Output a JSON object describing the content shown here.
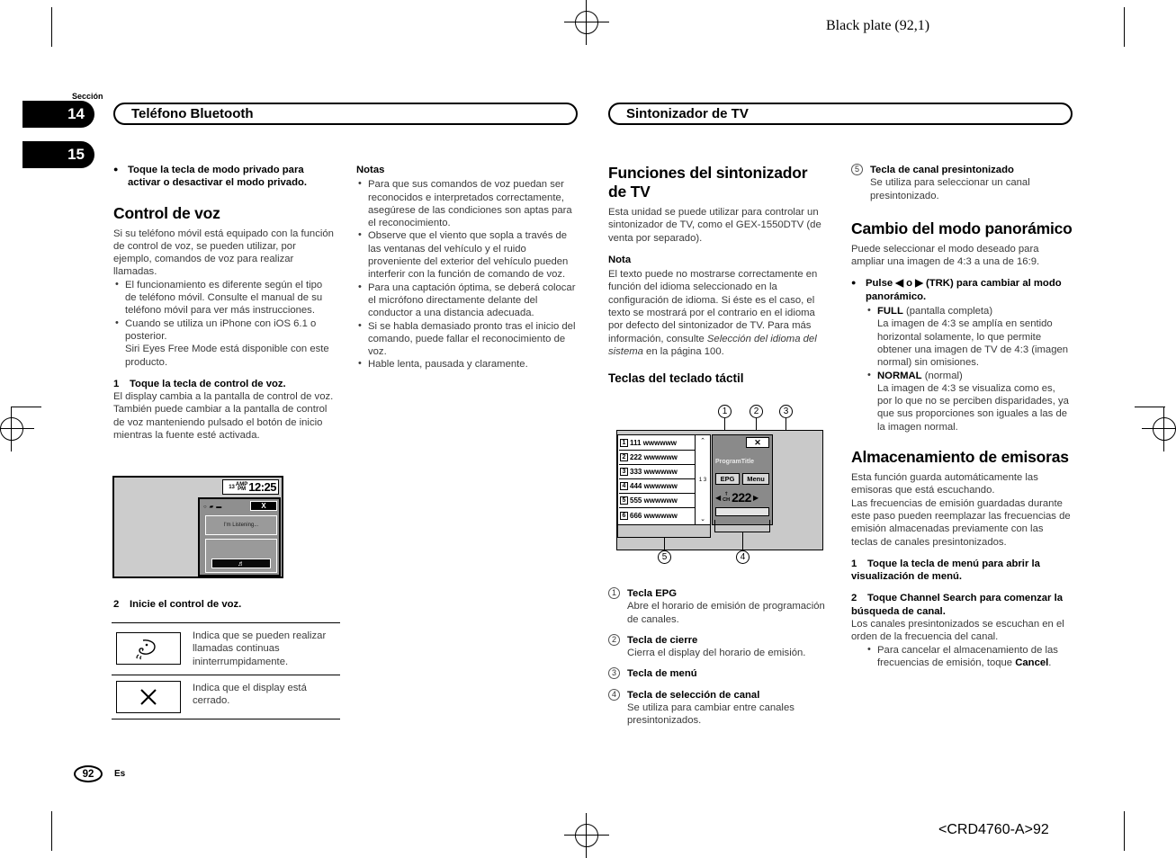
{
  "print_marks": {
    "black_plate": "Black plate (92,1)",
    "footer_code": "<CRD4760-A>92"
  },
  "section_tabs": {
    "label": "Sección",
    "numbers": [
      "14",
      "15"
    ]
  },
  "running_headers": {
    "left": "Teléfono Bluetooth",
    "right": "Sintonizador de TV"
  },
  "column1": {
    "lead_bullet": "Toque la tecla de modo privado para activar o desactivar el modo privado.",
    "heading": "Control de voz",
    "intro": "Si su teléfono móvil está equipado con la función de control de voz, se pueden utilizar, por ejemplo, comandos de voz para realizar llamadas.",
    "bullets": [
      "El funcionamiento es diferente según el tipo de teléfono móvil. Consulte el manual de su teléfono móvil para ver más instrucciones.",
      "Cuando se utiliza un iPhone con iOS 6.1 o posterior.",
      "Siri Eyes Free Mode está disponible con este producto."
    ],
    "step1_num": "1",
    "step1_title": "Toque la tecla de control de voz.",
    "step1_body": "El display cambia a la pantalla de control de voz. También puede cambiar a la pantalla de control de voz manteniendo pulsado el botón de inicio mientras la fuente esté activada.",
    "figure": {
      "clock_date": "13",
      "clock_ampm_top": "AMP",
      "clock_ampm_bottom": "PM",
      "clock_time": "12:25",
      "close_label": "X",
      "listening_text": "I'm Listening...",
      "mic_icon": "mic-icon",
      "status_icons": [
        "circle-icon",
        "signal-icon",
        "battery-icon"
      ]
    },
    "step2_num": "2",
    "step2_title": "Inicie el control de voz.",
    "icon_table": [
      {
        "icon": "speech-mouth-icon",
        "glyph": "",
        "desc": "Indica que se pueden realizar llamadas continuas ininterrumpidamente."
      },
      {
        "icon": "close-x-icon",
        "glyph": "✕",
        "desc": "Indica que el display está cerrado."
      }
    ]
  },
  "column2": {
    "notes_title": "Notas",
    "notes": [
      "Para que sus comandos de voz puedan ser reconocidos e interpretados correctamente, asegúrese de las condiciones son aptas para el reconocimiento.",
      "Observe que el viento que sopla a través de las ventanas del vehículo y el ruido proveniente del exterior del vehículo pueden interferir con la función de comando de voz.",
      "Para una captación óptima, se deberá colocar el micrófono directamente delante del conductor a una distancia adecuada.",
      "Si se habla demasiado pronto tras el inicio del comando, puede fallar el reconocimiento de voz.",
      "Hable lenta, pausada y claramente."
    ]
  },
  "column3": {
    "heading": "Funciones del sintonizador de TV",
    "intro": "Esta unidad se puede utilizar para controlar un sintonizador de TV, como el GEX-1550DTV (de venta por separado).",
    "note_title": "Nota",
    "note_part1": "El texto puede no mostrarse correctamente en función del idioma seleccionado en la configuración de idioma. Si éste es el caso, el texto se mostrará por el contrario en el idioma por defecto del sintonizador de TV. Para más información, consulte ",
    "note_italic": "Selección del idioma del sistema",
    "note_part2": " en la página 100.",
    "subheading": "Teclas del teclado táctil",
    "figure": {
      "channels": [
        {
          "num": "1",
          "label": "111 wwwwww"
        },
        {
          "num": "2",
          "label": "222 wwwwww"
        },
        {
          "num": "3",
          "label": "333 wwwwww"
        },
        {
          "num": "4",
          "label": "444 wwwwww"
        },
        {
          "num": "5",
          "label": "555 wwwwww"
        },
        {
          "num": "6",
          "label": "666 wwwwww"
        }
      ],
      "page_current": "1",
      "page_total": "3",
      "scroll_up": "⌃",
      "scroll_down": "⌄",
      "close_label": "✕",
      "program_title": "ProgramTitle",
      "epg_label": "EPG",
      "menu_label": "Menu",
      "ch_label": "CH",
      "ch_number": "222",
      "arrow_left": "◀",
      "arrow_right": "▶",
      "callout_numbers": [
        "1",
        "2",
        "3",
        "4",
        "5"
      ]
    },
    "callouts": [
      {
        "num": "①",
        "title": "Tecla EPG",
        "desc": "Abre el horario de emisión de programación de canales."
      },
      {
        "num": "②",
        "title": "Tecla de cierre",
        "desc": "Cierra el display del horario de emisión."
      },
      {
        "num": "③",
        "title": "Tecla de menú",
        "desc": ""
      },
      {
        "num": "④",
        "title": "Tecla de selección de canal",
        "desc": "Se utiliza para cambiar entre canales presintonizados."
      }
    ]
  },
  "column4": {
    "callout5": {
      "num": "⑤",
      "title": "Tecla de canal presintonizado",
      "desc": "Se utiliza para seleccionar un canal presintonizado."
    },
    "heading_wide": "Cambio del modo panorámico",
    "wide_intro": "Puede seleccionar el modo deseado para ampliar una imagen de 4:3 a una de 16:9.",
    "wide_bullet": "Pulse ◀ o ▶ (TRK) para cambiar al modo panorámico.",
    "modes": [
      {
        "name": "FULL",
        "paren": "(pantalla completa)",
        "desc": "La imagen de 4:3 se amplía en sentido horizontal solamente, lo que permite obtener una imagen de TV de 4:3 (imagen normal) sin omisiones."
      },
      {
        "name": "NORMAL",
        "paren": "(normal)",
        "desc": "La imagen de 4:3 se visualiza como es, por lo que no se perciben disparidades, ya que sus proporciones son iguales a las de la imagen normal."
      }
    ],
    "heading_store": "Almacenamiento de emisoras",
    "store_intro1": "Esta función guarda automáticamente las emisoras que está escuchando.",
    "store_intro2": "Las frecuencias de emisión guardadas durante este paso pueden reemplazar las frecuencias de emisión almacenadas previamente con las teclas de canales presintonizados.",
    "step1_num": "1",
    "step1_title": "Toque la tecla de menú para abrir la visualización de menú.",
    "step2_num": "2",
    "step2_title": "Toque Channel Search para comenzar la búsqueda de canal.",
    "step2_body": "Los canales presintonizados se escuchan en el orden de la frecuencia del canal.",
    "cancel_note_part1": "Para cancelar el almacenamiento de las frecuencias de emisión, toque ",
    "cancel_note_bold": "Cancel",
    "cancel_note_part2": "."
  },
  "page_footer": {
    "page_number": "92",
    "language": "Es"
  }
}
